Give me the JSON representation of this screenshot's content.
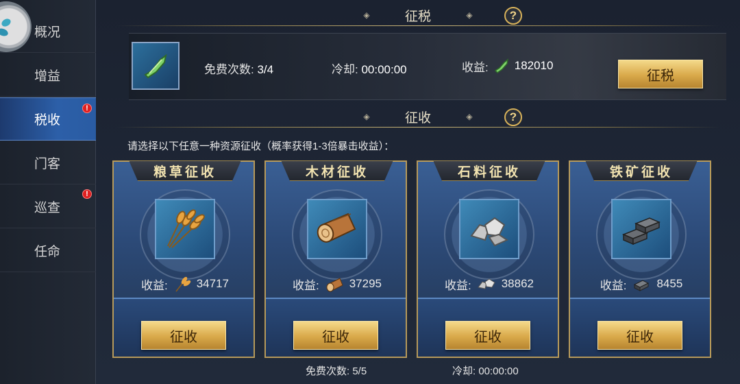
{
  "sidebar": {
    "items": [
      {
        "label": "概况",
        "active": false,
        "badge": ""
      },
      {
        "label": "增益",
        "active": false,
        "badge": ""
      },
      {
        "label": "税收",
        "active": true,
        "badge": "!"
      },
      {
        "label": "门客",
        "active": false,
        "badge": ""
      },
      {
        "label": "巡查",
        "active": false,
        "badge": "!"
      },
      {
        "label": "任命",
        "active": false,
        "badge": ""
      }
    ]
  },
  "tax": {
    "title": "征税",
    "help": "?",
    "free_label": "免费次数: ",
    "free_value": "3/4",
    "cooldown_label": "冷却: ",
    "cooldown_value": "00:00:00",
    "income_label": "收益:",
    "income_value": "182010",
    "button_label": "征税"
  },
  "collect": {
    "title": "征收",
    "help": "?",
    "instruction": "请选择以下任意一种资源征收（概率获得1-3倍暴击收益）：",
    "cards": [
      {
        "title": "粮草征收",
        "income_label": "收益:",
        "income_value": "34717",
        "button_label": "征收",
        "icon": "wheat-icon"
      },
      {
        "title": "木材征收",
        "income_label": "收益:",
        "income_value": "37295",
        "button_label": "征收",
        "icon": "wood-log-icon"
      },
      {
        "title": "石料征收",
        "income_label": "收益:",
        "income_value": "38862",
        "button_label": "征收",
        "icon": "stone-icon"
      },
      {
        "title": "铁矿征收",
        "income_label": "收益:",
        "income_value": "8455",
        "button_label": "征收",
        "icon": "iron-ingot-icon"
      }
    ],
    "free_text": "免费次数: 5/5",
    "cooldown_text": "冷却:  00:00:00"
  }
}
